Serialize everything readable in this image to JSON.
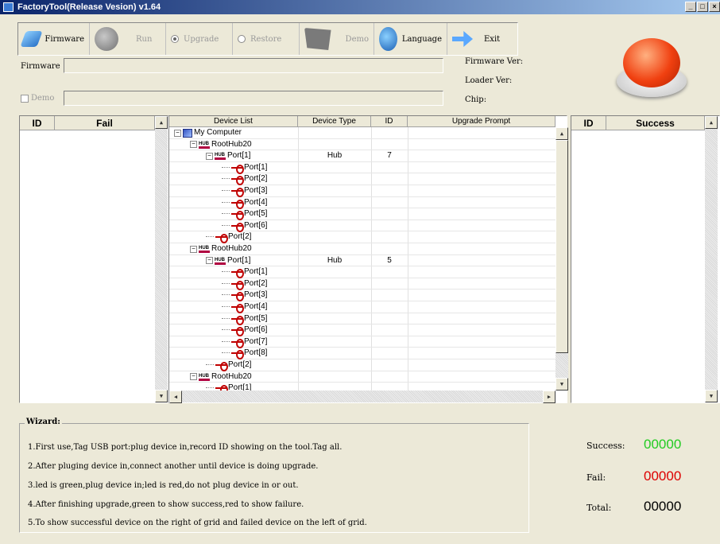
{
  "window": {
    "title": "FactoryTool(Release Vesion) v1.64",
    "controls": [
      "_",
      "□",
      "×"
    ]
  },
  "toolbar": {
    "firmware": "Firmware",
    "run": "Run",
    "upgrade": "Upgrade",
    "restore": "Restore",
    "demo": "Demo",
    "language": "Language",
    "exit": "Exit",
    "upgrade_selected": true
  },
  "form": {
    "firmware_label": "Firmware",
    "firmware_value": "",
    "demo_label": "Demo",
    "demo_value": "",
    "firmware_ver_label": "Firmware Ver:",
    "loader_ver_label": "Loader Ver:",
    "chip_label": "Chip:"
  },
  "fail_grid": {
    "id_header": "ID",
    "fail_header": "Fail"
  },
  "success_grid": {
    "id_header": "ID",
    "success_header": "Success"
  },
  "device_grid": {
    "headers": [
      "Device List",
      "Device Type",
      "ID",
      "Upgrade Prompt"
    ],
    "rows": [
      {
        "level": 0,
        "icon": "computer",
        "expander": "-",
        "name": "My Computer",
        "type": "",
        "id": ""
      },
      {
        "level": 1,
        "icon": "hub",
        "expander": "-",
        "name": "RootHub20",
        "type": "",
        "id": ""
      },
      {
        "level": 2,
        "icon": "hub",
        "expander": "-",
        "name": "Port[1]",
        "type": "Hub",
        "id": "7"
      },
      {
        "level": 3,
        "icon": "usb",
        "expander": "",
        "name": "Port[1]",
        "type": "",
        "id": ""
      },
      {
        "level": 3,
        "icon": "usb",
        "expander": "",
        "name": "Port[2]",
        "type": "",
        "id": ""
      },
      {
        "level": 3,
        "icon": "usb",
        "expander": "",
        "name": "Port[3]",
        "type": "",
        "id": ""
      },
      {
        "level": 3,
        "icon": "usb",
        "expander": "",
        "name": "Port[4]",
        "type": "",
        "id": ""
      },
      {
        "level": 3,
        "icon": "usb",
        "expander": "",
        "name": "Port[5]",
        "type": "",
        "id": ""
      },
      {
        "level": 3,
        "icon": "usb",
        "expander": "",
        "name": "Port[6]",
        "type": "",
        "id": ""
      },
      {
        "level": 2,
        "icon": "usb",
        "expander": "",
        "name": "Port[2]",
        "type": "",
        "id": ""
      },
      {
        "level": 1,
        "icon": "hub",
        "expander": "-",
        "name": "RootHub20",
        "type": "",
        "id": ""
      },
      {
        "level": 2,
        "icon": "hub",
        "expander": "-",
        "name": "Port[1]",
        "type": "Hub",
        "id": "5"
      },
      {
        "level": 3,
        "icon": "usb",
        "expander": "",
        "name": "Port[1]",
        "type": "",
        "id": ""
      },
      {
        "level": 3,
        "icon": "usb",
        "expander": "",
        "name": "Port[2]",
        "type": "",
        "id": ""
      },
      {
        "level": 3,
        "icon": "usb",
        "expander": "",
        "name": "Port[3]",
        "type": "",
        "id": ""
      },
      {
        "level": 3,
        "icon": "usb",
        "expander": "",
        "name": "Port[4]",
        "type": "",
        "id": ""
      },
      {
        "level": 3,
        "icon": "usb",
        "expander": "",
        "name": "Port[5]",
        "type": "",
        "id": ""
      },
      {
        "level": 3,
        "icon": "usb",
        "expander": "",
        "name": "Port[6]",
        "type": "",
        "id": ""
      },
      {
        "level": 3,
        "icon": "usb",
        "expander": "",
        "name": "Port[7]",
        "type": "",
        "id": ""
      },
      {
        "level": 3,
        "icon": "usb",
        "expander": "",
        "name": "Port[8]",
        "type": "",
        "id": ""
      },
      {
        "level": 2,
        "icon": "usb",
        "expander": "",
        "name": "Port[2]",
        "type": "",
        "id": ""
      },
      {
        "level": 1,
        "icon": "hub",
        "expander": "-",
        "name": "RootHub20",
        "type": "",
        "id": ""
      },
      {
        "level": 2,
        "icon": "usb",
        "expander": "",
        "name": "Port[1]",
        "type": "",
        "id": ""
      }
    ]
  },
  "wizard": {
    "title": "Wizard:",
    "lines": [
      "1.First use,Tag USB port:plug device in,record ID showing on the tool.Tag all.",
      "2.After pluging device in,connect another until device is doing upgrade.",
      "3.led is green,plug device in;led is red,do not plug device in or out.",
      "4.After finishing upgrade,green to show success,red to show failure.",
      "5.To show successful device on the right of grid and failed device on the left of grid."
    ]
  },
  "stats": {
    "success_label": "Success:",
    "success_value": "00000",
    "success_color": "#22cc22",
    "fail_label": "Fail:",
    "fail_value": "00000",
    "fail_color": "#dd0000",
    "total_label": "Total:",
    "total_value": "00000",
    "total_color": "#000000"
  }
}
